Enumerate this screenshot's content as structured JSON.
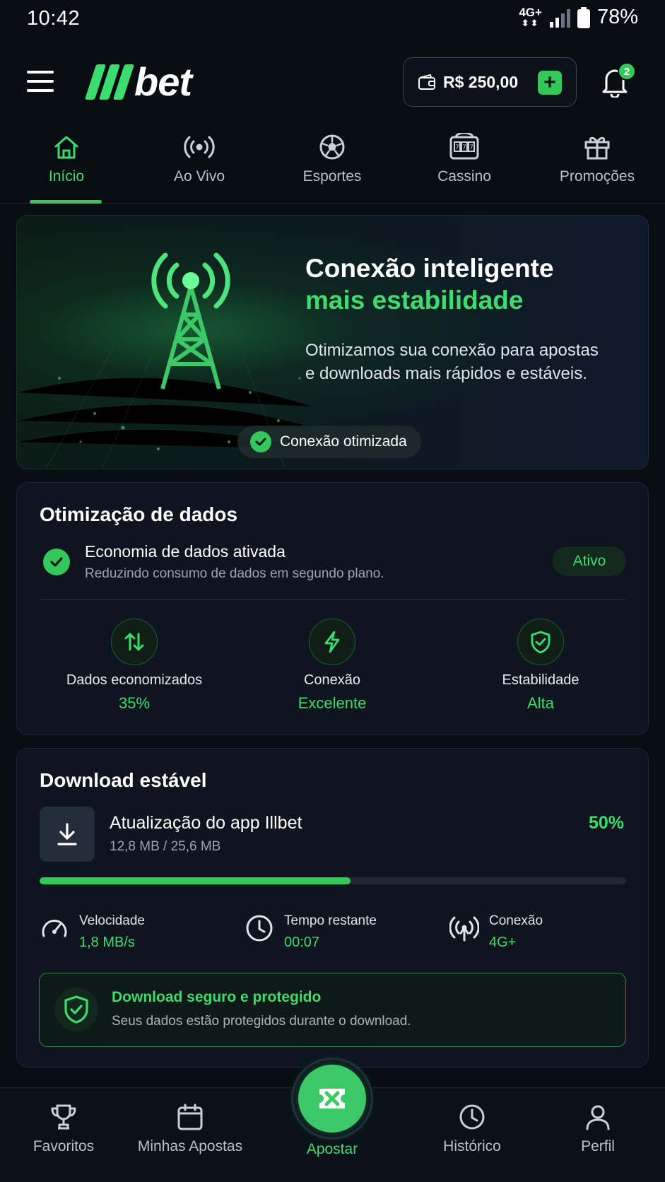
{
  "status_bar": {
    "time": "10:42",
    "network": "4G+",
    "battery": "78%"
  },
  "header": {
    "logo_text": "bet",
    "wallet_balance": "R$ 250,00",
    "add_symbol": "+",
    "notification_count": "2"
  },
  "top_nav": [
    {
      "label": "Início",
      "icon": "home-icon",
      "active": true
    },
    {
      "label": "Ao Vivo",
      "icon": "live-broadcast-icon",
      "active": false
    },
    {
      "label": "Esportes",
      "icon": "soccer-ball-icon",
      "active": false
    },
    {
      "label": "Cassino",
      "icon": "slot-machine-icon",
      "active": false
    },
    {
      "label": "Promoções",
      "icon": "gift-icon",
      "active": false
    }
  ],
  "hero": {
    "title": "Conexão inteligente",
    "title_highlight": "mais estabilidade",
    "description": "Otimizamos sua conexão para apostas e downloads mais rápidos e estáveis.",
    "badge": "Conexão otimizada"
  },
  "data_optimization": {
    "title": "Otimização de dados",
    "item_title": "Economia de dados ativada",
    "item_subtitle": "Reduzindo consumo de dados em segundo plano.",
    "status": "Ativo",
    "stats": [
      {
        "label": "Dados economizados",
        "value": "35%",
        "icon": "arrows-up-down-icon"
      },
      {
        "label": "Conexão",
        "value": "Excelente",
        "icon": "lightning-icon"
      },
      {
        "label": "Estabilidade",
        "value": "Alta",
        "icon": "shield-check-icon"
      }
    ]
  },
  "download": {
    "title": "Download estável",
    "item_title": "Atualização do app Illbet",
    "size": "12,8 MB / 25,6 MB",
    "percent": "50%",
    "progress": 0.53,
    "metrics": [
      {
        "label": "Velocidade",
        "value": "1,8 MB/s",
        "icon": "speedometer-icon"
      },
      {
        "label": "Tempo restante",
        "value": "00:07",
        "icon": "clock-icon"
      },
      {
        "label": "Conexão",
        "value": "4G+",
        "icon": "signal-tower-icon"
      }
    ],
    "secure_title": "Download seguro e protegido",
    "secure_subtitle": "Seus dados estão protegidos durante o download."
  },
  "bottom_nav": [
    {
      "label": "Favoritos",
      "icon": "trophy-icon"
    },
    {
      "label": "Minhas Apostas",
      "icon": "calendar-icon"
    },
    {
      "label": "Apostar",
      "icon": "bet-ticket-icon"
    },
    {
      "label": "Histórico",
      "icon": "clock-icon"
    },
    {
      "label": "Perfil",
      "icon": "user-icon"
    }
  ],
  "colors": {
    "accent": "#34c759",
    "accent_text": "#3ddc6e",
    "background": "#080d14",
    "card": "#0e151f"
  }
}
